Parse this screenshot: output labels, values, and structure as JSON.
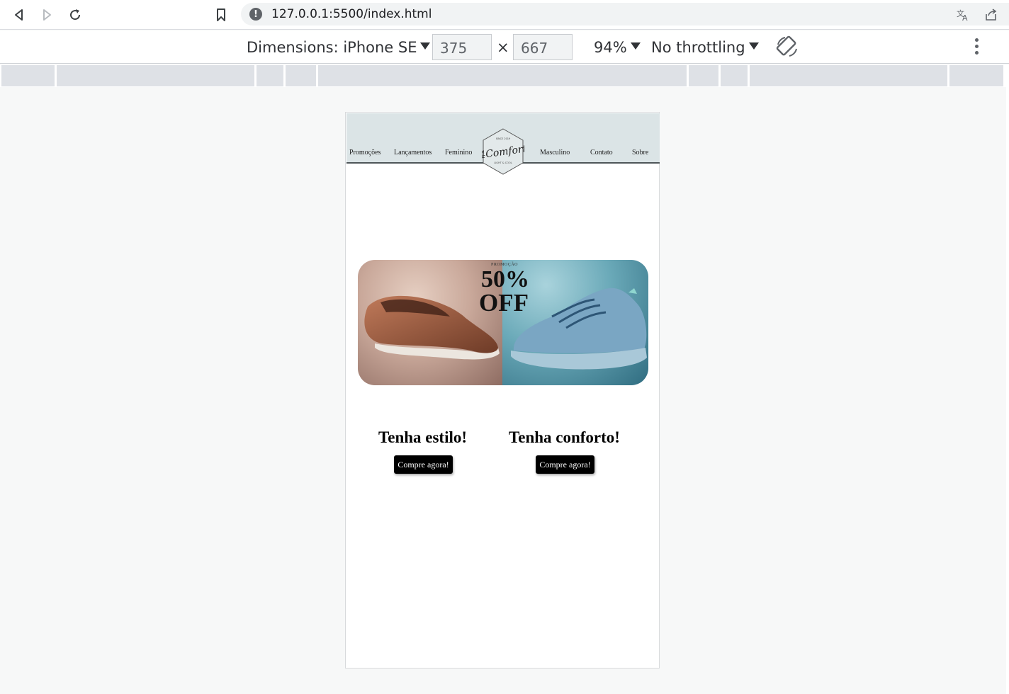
{
  "browser": {
    "url": "127.0.0.1:5500/index.html",
    "back_icon": "back-arrow-icon",
    "forward_icon": "forward-arrow-icon",
    "reload_icon": "reload-icon",
    "bookmark_icon": "bookmark-icon",
    "translate_icon": "translate-icon",
    "share_icon": "share-icon"
  },
  "device_toolbar": {
    "dimensions_label": "Dimensions: iPhone SE",
    "width_value": "375",
    "times_symbol": "×",
    "height_value": "667",
    "zoom": "94%",
    "throttling": "No throttling"
  },
  "site": {
    "nav": {
      "promocoes": "Promoções",
      "lancamentos": "Lançamentos",
      "feminino": "Feminino",
      "masculino": "Masculino",
      "contato": "Contato",
      "sobre": "Sobre"
    },
    "logo": {
      "top_text": "SINCE 2019",
      "brand": "4Comfort",
      "bottom_text": "LIGHT & COOL"
    },
    "banner": {
      "label": "PROMOÇÃO",
      "percent": "50%",
      "off": "OFF"
    },
    "cta_left": {
      "title": "Tenha estilo!",
      "button": "Compre agora!"
    },
    "cta_right": {
      "title": "Tenha conforto!",
      "button": "Compre agora!"
    }
  },
  "colors": {
    "header_bg": "#dbe4e6",
    "button_bg": "#000000"
  }
}
